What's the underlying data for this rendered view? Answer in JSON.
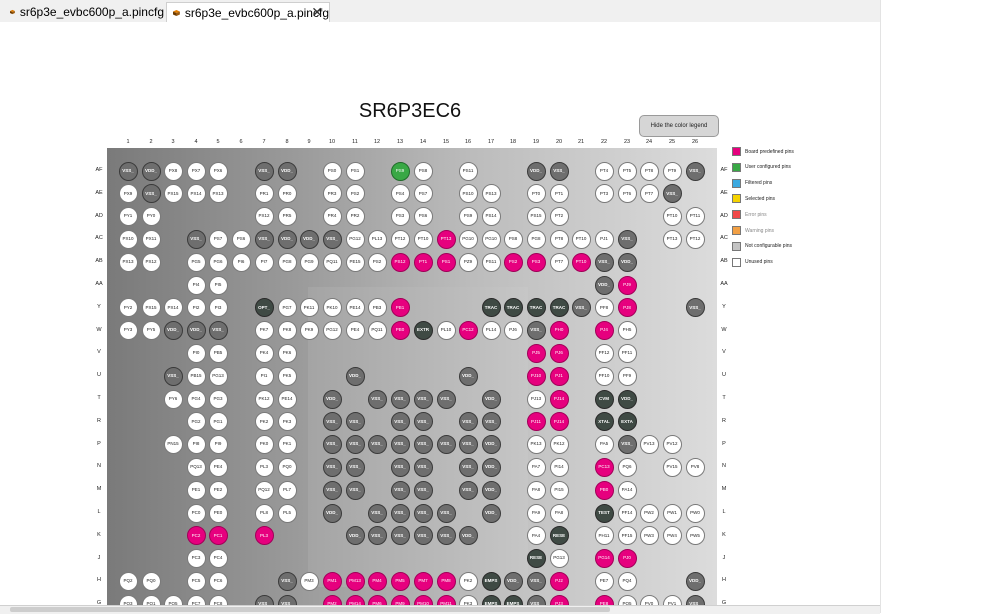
{
  "tabs": [
    {
      "label": "sr6p3e_evbc600p_a.pincfg",
      "active": false
    },
    {
      "label": "sr6p3e_evbc600p_a.pincfg",
      "active": true
    }
  ],
  "chip_title": "SR6P3EC6",
  "hide_legend_button": "Hide the color legend",
  "columns": [
    "1",
    "2",
    "3",
    "4",
    "5",
    "6",
    "7",
    "8",
    "9",
    "10",
    "11",
    "12",
    "13",
    "14",
    "15",
    "16",
    "17",
    "18",
    "19",
    "20",
    "21",
    "22",
    "23",
    "24",
    "25",
    "26"
  ],
  "rows": [
    "AF",
    "AE",
    "AD",
    "AC",
    "AB",
    "AA",
    "Y",
    "W",
    "V",
    "U",
    "T",
    "R",
    "P",
    "N",
    "M",
    "L",
    "K",
    "J",
    "H",
    "G"
  ],
  "legend": [
    {
      "label": "Board predefined pins",
      "color": "#e6007e"
    },
    {
      "label": "User configured pins",
      "color": "#39a845"
    },
    {
      "label": "Filtered pins",
      "color": "#3ba9e0"
    },
    {
      "label": "Selected pins",
      "color": "#f5d300"
    },
    {
      "label": "Error pins",
      "color": "#f04848"
    },
    {
      "label": "Warning pins",
      "color": "#f2a044"
    },
    {
      "label": "Not configurable pins",
      "color": "#c4c4c4"
    },
    {
      "label": "Unused pins",
      "color": "#ffffff"
    }
  ],
  "pins": {
    "AF": [
      [
        1,
        "n",
        "VSS_"
      ],
      [
        2,
        "n",
        "VDD_"
      ],
      [
        3,
        "u",
        "PX8"
      ],
      [
        4,
        "u",
        "PX7"
      ],
      [
        5,
        "u",
        "PX6"
      ],
      [
        7,
        "n",
        "VSS_"
      ],
      [
        8,
        "n",
        "VDD_"
      ],
      [
        10,
        "u",
        "PS0"
      ],
      [
        11,
        "u",
        "PS1"
      ],
      [
        13,
        "g",
        "PS9"
      ],
      [
        14,
        "u",
        "PS8"
      ],
      [
        16,
        "u",
        "PS11"
      ],
      [
        19,
        "n",
        "VDD_"
      ],
      [
        20,
        "n",
        "VSS_"
      ],
      [
        22,
        "u",
        "PT4"
      ],
      [
        23,
        "u",
        "PT5"
      ],
      [
        24,
        "u",
        "PT8"
      ],
      [
        25,
        "u",
        "PT9"
      ],
      [
        26,
        "n",
        "VSS_"
      ]
    ],
    "AE": [
      [
        1,
        "u",
        "PX9"
      ],
      [
        2,
        "n",
        "VSS_"
      ],
      [
        3,
        "u",
        "PX15"
      ],
      [
        4,
        "u",
        "PX14"
      ],
      [
        5,
        "u",
        "PX13"
      ],
      [
        7,
        "u",
        "PR1"
      ],
      [
        8,
        "u",
        "PR0"
      ],
      [
        10,
        "u",
        "PR3"
      ],
      [
        11,
        "u",
        "PS2"
      ],
      [
        13,
        "u",
        "PS4"
      ],
      [
        14,
        "u",
        "PS7"
      ],
      [
        16,
        "u",
        "PS10"
      ],
      [
        17,
        "u",
        "PS13"
      ],
      [
        19,
        "u",
        "PT0"
      ],
      [
        20,
        "u",
        "PT1"
      ],
      [
        22,
        "u",
        "PT3"
      ],
      [
        23,
        "u",
        "PT6"
      ],
      [
        24,
        "u",
        "PT7"
      ],
      [
        25,
        "n",
        "VSS_"
      ]
    ],
    "AD": [
      [
        1,
        "u",
        "PY1"
      ],
      [
        2,
        "u",
        "PY0"
      ],
      [
        7,
        "u",
        "PX12"
      ],
      [
        8,
        "u",
        "PR5"
      ],
      [
        10,
        "u",
        "PR4"
      ],
      [
        11,
        "u",
        "PR2"
      ],
      [
        13,
        "u",
        "PS3"
      ],
      [
        14,
        "u",
        "PS6"
      ],
      [
        16,
        "u",
        "PS9"
      ],
      [
        17,
        "u",
        "PS14"
      ],
      [
        19,
        "u",
        "PS15"
      ],
      [
        20,
        "u",
        "PT2"
      ],
      [
        25,
        "u",
        "PT10"
      ],
      [
        26,
        "u",
        "PT11"
      ]
    ],
    "AC": [
      [
        1,
        "u",
        "PX10"
      ],
      [
        2,
        "u",
        "PX11"
      ],
      [
        4,
        "n",
        "VSS_"
      ],
      [
        5,
        "u",
        "PS7"
      ],
      [
        6,
        "u",
        "PS6"
      ],
      [
        7,
        "n",
        "VSS_"
      ],
      [
        8,
        "n",
        "VDD_"
      ],
      [
        9,
        "n",
        "VDD_"
      ],
      [
        10,
        "n",
        "VSS_"
      ],
      [
        11,
        "u",
        "PG12"
      ],
      [
        12,
        "u",
        "PL13"
      ],
      [
        13,
        "u",
        "PT12"
      ],
      [
        14,
        "u",
        "PT10"
      ],
      [
        15,
        "b",
        "PT13"
      ],
      [
        16,
        "u",
        "PG10"
      ],
      [
        17,
        "u",
        "PG10"
      ],
      [
        18,
        "u",
        "PS8"
      ],
      [
        19,
        "u",
        "PG8"
      ],
      [
        20,
        "u",
        "PT8"
      ],
      [
        21,
        "u",
        "PT10"
      ],
      [
        22,
        "u",
        "PJ1"
      ],
      [
        23,
        "n",
        "VSS_"
      ],
      [
        25,
        "u",
        "PT13"
      ],
      [
        26,
        "u",
        "PT12"
      ]
    ],
    "AB": [
      [
        1,
        "u",
        "PX13"
      ],
      [
        2,
        "u",
        "PX12"
      ],
      [
        4,
        "u",
        "PG5"
      ],
      [
        5,
        "u",
        "PG6"
      ],
      [
        6,
        "u",
        "PI6"
      ],
      [
        7,
        "u",
        "PI7"
      ],
      [
        8,
        "u",
        "PG8"
      ],
      [
        9,
        "u",
        "PG9"
      ],
      [
        10,
        "u",
        "PQ11"
      ],
      [
        11,
        "u",
        "PE15"
      ],
      [
        12,
        "u",
        "PS2"
      ],
      [
        13,
        "b",
        "PS12"
      ],
      [
        14,
        "b",
        "PT1"
      ],
      [
        15,
        "b",
        "PS1"
      ],
      [
        16,
        "u",
        "PZ9"
      ],
      [
        17,
        "u",
        "PS11"
      ],
      [
        18,
        "b",
        "PS2"
      ],
      [
        19,
        "b",
        "PS3"
      ],
      [
        20,
        "u",
        "PT7"
      ],
      [
        21,
        "b",
        "PT10"
      ],
      [
        22,
        "n",
        "VSS_"
      ],
      [
        23,
        "n",
        "VDD_"
      ]
    ],
    "AA": [
      [
        4,
        "u",
        "PI4"
      ],
      [
        5,
        "u",
        "PI5"
      ],
      [
        22,
        "n",
        "VDD_"
      ],
      [
        23,
        "b",
        "PJ9"
      ]
    ],
    "Y": [
      [
        1,
        "u",
        "PY2"
      ],
      [
        2,
        "u",
        "PX15"
      ],
      [
        3,
        "u",
        "PX14"
      ],
      [
        4,
        "u",
        "PI2"
      ],
      [
        5,
        "u",
        "PI3"
      ],
      [
        7,
        "d",
        "OPT_"
      ],
      [
        8,
        "u",
        "PG7"
      ],
      [
        9,
        "u",
        "PK11"
      ],
      [
        10,
        "u",
        "PK10"
      ],
      [
        11,
        "u",
        "PE14"
      ],
      [
        12,
        "u",
        "PB3"
      ],
      [
        13,
        "b",
        "PB1"
      ],
      [
        17,
        "d",
        "TRAC"
      ],
      [
        18,
        "d",
        "TRAC"
      ],
      [
        19,
        "d",
        "TRAC"
      ],
      [
        20,
        "d",
        "TRAC"
      ],
      [
        21,
        "n",
        "VSS_"
      ],
      [
        22,
        "u",
        "PF8"
      ],
      [
        23,
        "b",
        "PJ8"
      ],
      [
        26,
        "n",
        "VSS_"
      ]
    ],
    "W": [
      [
        1,
        "u",
        "PY3"
      ],
      [
        2,
        "u",
        "PY5"
      ],
      [
        3,
        "n",
        "VDD_"
      ],
      [
        4,
        "n",
        "VDD_"
      ],
      [
        5,
        "n",
        "VSS_"
      ],
      [
        7,
        "u",
        "PK7"
      ],
      [
        8,
        "u",
        "PK8"
      ],
      [
        9,
        "u",
        "PK9"
      ],
      [
        10,
        "u",
        "PG12"
      ],
      [
        11,
        "u",
        "PE4"
      ],
      [
        12,
        "u",
        "PQ11"
      ],
      [
        13,
        "b",
        "PB0"
      ],
      [
        14,
        "d",
        "EXTR"
      ],
      [
        15,
        "u",
        "PL10"
      ],
      [
        16,
        "b",
        "PC12"
      ],
      [
        17,
        "u",
        "PL14"
      ],
      [
        18,
        "u",
        "PJ6"
      ],
      [
        19,
        "n",
        "VSS_"
      ],
      [
        20,
        "b",
        "PH0"
      ],
      [
        22,
        "b",
        "PJ4"
      ],
      [
        23,
        "u",
        "PH5"
      ]
    ],
    "V": [
      [
        4,
        "u",
        "PI0"
      ],
      [
        5,
        "u",
        "PB5"
      ],
      [
        7,
        "u",
        "PK4"
      ],
      [
        8,
        "u",
        "PK6"
      ],
      [
        19,
        "b",
        "PJ5"
      ],
      [
        20,
        "b",
        "PJ6"
      ],
      [
        22,
        "u",
        "PF12"
      ],
      [
        23,
        "u",
        "PF11"
      ]
    ],
    "U": [
      [
        3,
        "n",
        "VSS_"
      ],
      [
        4,
        "u",
        "PB15"
      ],
      [
        5,
        "u",
        "PG13"
      ],
      [
        7,
        "u",
        "PI1"
      ],
      [
        8,
        "u",
        "PK5"
      ],
      [
        11,
        "n",
        "VDD_"
      ],
      [
        16,
        "n",
        "VDD_"
      ],
      [
        19,
        "b",
        "PJ10"
      ],
      [
        20,
        "b",
        "PJ1"
      ],
      [
        22,
        "u",
        "PF10"
      ],
      [
        23,
        "u",
        "PF9"
      ]
    ],
    "T": [
      [
        3,
        "u",
        "PY6"
      ],
      [
        4,
        "u",
        "PG4"
      ],
      [
        5,
        "u",
        "PG3"
      ],
      [
        7,
        "u",
        "PK12"
      ],
      [
        8,
        "u",
        "PE14"
      ],
      [
        10,
        "n",
        "VDD_"
      ],
      [
        12,
        "n",
        "VSS_"
      ],
      [
        13,
        "n",
        "VSS_"
      ],
      [
        14,
        "n",
        "VSS_"
      ],
      [
        15,
        "n",
        "VSS_"
      ],
      [
        17,
        "n",
        "VDD_"
      ],
      [
        19,
        "u",
        "PJ13"
      ],
      [
        20,
        "b",
        "PJ14"
      ],
      [
        22,
        "d",
        "CVM"
      ],
      [
        23,
        "d",
        "VDD_"
      ]
    ],
    "R": [
      [
        4,
        "u",
        "PG2"
      ],
      [
        5,
        "u",
        "PG1"
      ],
      [
        7,
        "u",
        "PK2"
      ],
      [
        8,
        "u",
        "PK3"
      ],
      [
        10,
        "n",
        "VSS_"
      ],
      [
        11,
        "n",
        "VSS_"
      ],
      [
        13,
        "n",
        "VSS_"
      ],
      [
        14,
        "n",
        "VSS_"
      ],
      [
        16,
        "n",
        "VSS_"
      ],
      [
        17,
        "n",
        "VSS_"
      ],
      [
        19,
        "b",
        "PJ11"
      ],
      [
        20,
        "b",
        "PJ14"
      ],
      [
        22,
        "d",
        "XTAL"
      ],
      [
        23,
        "d",
        "EXTA"
      ]
    ],
    "P": [
      [
        3,
        "u",
        "PN15"
      ],
      [
        4,
        "u",
        "PI8"
      ],
      [
        5,
        "u",
        "PI9"
      ],
      [
        7,
        "u",
        "PK0"
      ],
      [
        8,
        "u",
        "PK1"
      ],
      [
        10,
        "n",
        "VSS_"
      ],
      [
        11,
        "n",
        "VSS_"
      ],
      [
        12,
        "n",
        "VSS_"
      ],
      [
        13,
        "n",
        "VSS_"
      ],
      [
        14,
        "n",
        "VSS_"
      ],
      [
        15,
        "n",
        "VSS_"
      ],
      [
        16,
        "n",
        "VSS_"
      ],
      [
        17,
        "n",
        "VDD_"
      ],
      [
        19,
        "u",
        "PK13"
      ],
      [
        20,
        "u",
        "PK12"
      ],
      [
        22,
        "u",
        "PA5"
      ],
      [
        23,
        "n",
        "VSS_"
      ],
      [
        24,
        "u",
        "PV13"
      ],
      [
        25,
        "u",
        "PV12"
      ]
    ],
    "N": [
      [
        4,
        "u",
        "PQ13"
      ],
      [
        5,
        "u",
        "PE4"
      ],
      [
        7,
        "u",
        "PL3"
      ],
      [
        8,
        "u",
        "PQ0"
      ],
      [
        10,
        "n",
        "VSS_"
      ],
      [
        11,
        "n",
        "VSS_"
      ],
      [
        13,
        "n",
        "VSS_"
      ],
      [
        14,
        "n",
        "VSS_"
      ],
      [
        16,
        "n",
        "VSS_"
      ],
      [
        17,
        "n",
        "VDD_"
      ],
      [
        19,
        "u",
        "PA7"
      ],
      [
        20,
        "u",
        "PI14"
      ],
      [
        22,
        "b",
        "PC13"
      ],
      [
        23,
        "u",
        "PQ6"
      ],
      [
        25,
        "u",
        "PV15"
      ],
      [
        26,
        "u",
        "PV8"
      ]
    ],
    "M": [
      [
        4,
        "u",
        "PE1"
      ],
      [
        5,
        "u",
        "PE2"
      ],
      [
        7,
        "u",
        "PQ12"
      ],
      [
        8,
        "u",
        "PL7"
      ],
      [
        10,
        "n",
        "VSS_"
      ],
      [
        11,
        "n",
        "VSS_"
      ],
      [
        13,
        "n",
        "VSS_"
      ],
      [
        14,
        "n",
        "VSS_"
      ],
      [
        16,
        "n",
        "VSS_"
      ],
      [
        17,
        "n",
        "VDD_"
      ],
      [
        19,
        "u",
        "PA8"
      ],
      [
        20,
        "u",
        "PI15"
      ],
      [
        22,
        "b",
        "PB0"
      ],
      [
        23,
        "u",
        "PA14"
      ]
    ],
    "L": [
      [
        4,
        "u",
        "PC0"
      ],
      [
        5,
        "u",
        "PE0"
      ],
      [
        7,
        "u",
        "PL8"
      ],
      [
        8,
        "u",
        "PL5"
      ],
      [
        10,
        "n",
        "VDD_"
      ],
      [
        12,
        "n",
        "VSS_"
      ],
      [
        13,
        "n",
        "VSS_"
      ],
      [
        14,
        "n",
        "VSS_"
      ],
      [
        15,
        "n",
        "VSS_"
      ],
      [
        17,
        "n",
        "VDD_"
      ],
      [
        19,
        "u",
        "PA9"
      ],
      [
        20,
        "u",
        "PA8"
      ],
      [
        22,
        "d",
        "TEST"
      ],
      [
        23,
        "u",
        "PF14"
      ],
      [
        24,
        "u",
        "PW2"
      ],
      [
        25,
        "u",
        "PW1"
      ],
      [
        26,
        "u",
        "PW0"
      ]
    ],
    "K": [
      [
        4,
        "b",
        "PC2"
      ],
      [
        5,
        "b",
        "PC1"
      ],
      [
        7,
        "b",
        "PL3"
      ],
      [
        11,
        "n",
        "VDD_"
      ],
      [
        12,
        "n",
        "VSS_"
      ],
      [
        13,
        "n",
        "VSS_"
      ],
      [
        14,
        "n",
        "VSS_"
      ],
      [
        15,
        "n",
        "VSS_"
      ],
      [
        16,
        "n",
        "VDD_"
      ],
      [
        19,
        "u",
        "PA4"
      ],
      [
        20,
        "d",
        "RESE"
      ],
      [
        22,
        "u",
        "PH11"
      ],
      [
        23,
        "u",
        "PF15"
      ],
      [
        24,
        "u",
        "PW3"
      ],
      [
        25,
        "u",
        "PW4"
      ],
      [
        26,
        "u",
        "PW5"
      ]
    ],
    "J": [
      [
        4,
        "u",
        "PC3"
      ],
      [
        5,
        "u",
        "PC4"
      ],
      [
        19,
        "d",
        "RESE"
      ],
      [
        20,
        "u",
        "PG13"
      ],
      [
        22,
        "b",
        "PG14"
      ],
      [
        23,
        "b",
        "PJ0"
      ]
    ],
    "H": [
      [
        1,
        "u",
        "PQ2"
      ],
      [
        2,
        "u",
        "PQ0"
      ],
      [
        4,
        "u",
        "PC5"
      ],
      [
        5,
        "u",
        "PC6"
      ],
      [
        8,
        "n",
        "VSS_"
      ],
      [
        9,
        "u",
        "PM3"
      ],
      [
        10,
        "b",
        "PM1"
      ],
      [
        11,
        "b",
        "PM13"
      ],
      [
        12,
        "b",
        "PM4"
      ],
      [
        13,
        "b",
        "PM5"
      ],
      [
        14,
        "b",
        "PM7"
      ],
      [
        15,
        "b",
        "PM8"
      ],
      [
        16,
        "u",
        "PK2"
      ],
      [
        17,
        "d",
        "EMPS"
      ],
      [
        18,
        "n",
        "VDD_"
      ],
      [
        19,
        "n",
        "VSS_"
      ],
      [
        20,
        "b",
        "PJ2"
      ],
      [
        22,
        "u",
        "PE7"
      ],
      [
        23,
        "u",
        "PQ4"
      ],
      [
        26,
        "n",
        "VDD_"
      ]
    ],
    "G": [
      [
        1,
        "u",
        "PQ3"
      ],
      [
        2,
        "u",
        "PQ1"
      ],
      [
        3,
        "u",
        "PQ5"
      ],
      [
        4,
        "u",
        "PC7"
      ],
      [
        5,
        "u",
        "PC8"
      ],
      [
        7,
        "n",
        "VSS_"
      ],
      [
        8,
        "n",
        "VSS_"
      ],
      [
        10,
        "b",
        "PM2"
      ],
      [
        11,
        "b",
        "PM14"
      ],
      [
        12,
        "b",
        "PM6"
      ],
      [
        13,
        "b",
        "PM9"
      ],
      [
        14,
        "b",
        "PM10"
      ],
      [
        15,
        "b",
        "PM11"
      ],
      [
        16,
        "u",
        "PK3"
      ],
      [
        17,
        "d",
        "EMPS"
      ],
      [
        18,
        "d",
        "EMPS"
      ],
      [
        19,
        "n",
        "VSS_"
      ],
      [
        20,
        "b",
        "PJ3"
      ],
      [
        22,
        "b",
        "PE8"
      ],
      [
        23,
        "u",
        "PQ5"
      ],
      [
        24,
        "u",
        "PV0"
      ],
      [
        25,
        "u",
        "PV1"
      ],
      [
        26,
        "n",
        "VSS_"
      ]
    ]
  }
}
